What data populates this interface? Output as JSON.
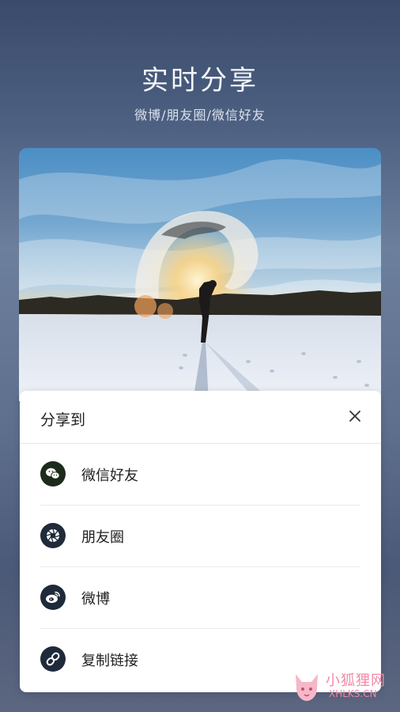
{
  "header": {
    "title": "实时分享",
    "subtitle": "微博/朋友圈/微信好友"
  },
  "photo": {
    "description_colors": {
      "sky": "#5d9ccd",
      "snow": "#dde3ee",
      "sun": "#ffd27a"
    }
  },
  "share_sheet": {
    "title": "分享到",
    "close_icon": "close-icon",
    "options": [
      {
        "label": "微信好友",
        "icon": "wechat-icon",
        "icon_bg": "#1d2b1c"
      },
      {
        "label": "朋友圈",
        "icon": "moments-icon",
        "icon_bg": "#1f2a3a"
      },
      {
        "label": "微博",
        "icon": "weibo-icon",
        "icon_bg": "#1f2a3a"
      },
      {
        "label": "复制链接",
        "icon": "link-icon",
        "icon_bg": "#1f2a3a"
      }
    ]
  },
  "watermark": {
    "cn": "小狐狸网",
    "en": "XHLKS.CN"
  }
}
